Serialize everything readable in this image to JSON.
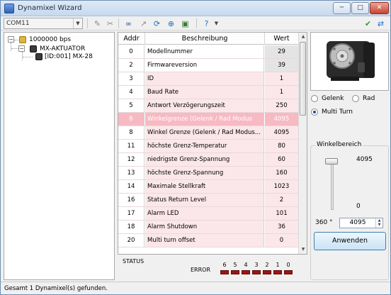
{
  "window": {
    "title": "Dynamixel Wizard"
  },
  "titlebar": {
    "min": "─",
    "max": "□",
    "close": "✕"
  },
  "toolbar": {
    "port": "COM11",
    "icons": [
      "tool-icon",
      "disconnect-icon",
      "binoculars-icon",
      "arrow-icon",
      "refresh-icon",
      "globe-icon",
      "network-icon",
      "help-icon",
      "check-icon",
      "sync-icon"
    ]
  },
  "tree": {
    "root": "1000000 bps",
    "child": "MX-AKTUATOR",
    "leaf": "[ID:001] MX-28"
  },
  "table": {
    "headers": {
      "addr": "Addr",
      "desc": "Beschreibung",
      "val": "Wert"
    },
    "rows": [
      {
        "addr": "0",
        "desc": "Modellnummer",
        "val": "29",
        "style": "readonly"
      },
      {
        "addr": "2",
        "desc": "Firmwareversion",
        "val": "39",
        "style": "readonly"
      },
      {
        "addr": "3",
        "desc": "ID",
        "val": "1",
        "style": "pink"
      },
      {
        "addr": "4",
        "desc": "Baud Rate",
        "val": "1",
        "style": "pink"
      },
      {
        "addr": "5",
        "desc": "Antwort Verzögerungszeit",
        "val": "250",
        "style": "pink"
      },
      {
        "addr": "6",
        "desc": "Winkelgrenze (Gelenk / Rad Modus",
        "val": "4095",
        "style": "selected"
      },
      {
        "addr": "8",
        "desc": "Winkel Grenze (Gelenk / Rad Modus...",
        "val": "4095",
        "style": "pink"
      },
      {
        "addr": "11",
        "desc": "höchste Grenz-Temperatur",
        "val": "80",
        "style": "pink"
      },
      {
        "addr": "12",
        "desc": "niedrigste Grenz-Spannung",
        "val": "60",
        "style": "pink"
      },
      {
        "addr": "13",
        "desc": "höchste Grenz-Spannung",
        "val": "160",
        "style": "pink"
      },
      {
        "addr": "14",
        "desc": "Maximale Stellkraft",
        "val": "1023",
        "style": "pink"
      },
      {
        "addr": "16",
        "desc": "Status Return Level",
        "val": "2",
        "style": "pink"
      },
      {
        "addr": "17",
        "desc": "Alarm LED",
        "val": "101",
        "style": "pink"
      },
      {
        "addr": "18",
        "desc": "Alarm Shutdown",
        "val": "36",
        "style": "pink"
      },
      {
        "addr": "20",
        "desc": "Multi turn offset",
        "val": "0",
        "style": "pink"
      }
    ]
  },
  "status": {
    "label": "STATUS",
    "error_label": "ERROR",
    "bits": [
      "6",
      "5",
      "4",
      "3",
      "2",
      "1",
      "0"
    ]
  },
  "mode": {
    "options": [
      {
        "label": "Gelenk",
        "checked": false
      },
      {
        "label": "Rad",
        "checked": false
      },
      {
        "label": "Multi Turn",
        "checked": true
      }
    ]
  },
  "angle": {
    "group_title": "Winkelbereich",
    "max_label": "4095",
    "min_label": "0",
    "deg_label": "360 °",
    "value": "4095",
    "slider_level": 1.0,
    "apply_label": "Anwenden"
  },
  "statusbar": {
    "message": "Gesamt 1 Dynamixel(s) gefunden."
  }
}
